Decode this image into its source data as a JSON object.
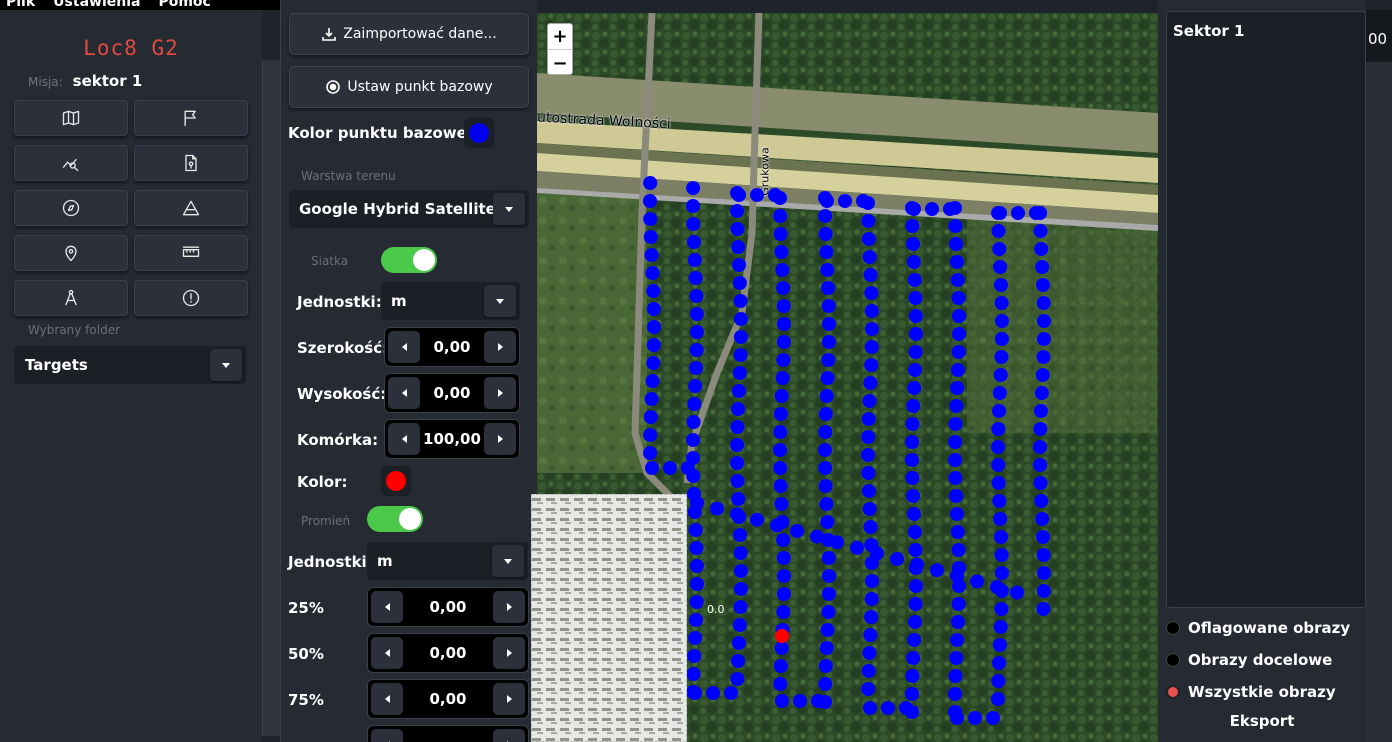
{
  "menu": [
    "Plik",
    "Ustawienia",
    "Pomoc"
  ],
  "app": {
    "logo": "Loc8 G2"
  },
  "mission": {
    "label": "Misja:",
    "value": "sektor 1"
  },
  "tools": [
    "map-icon",
    "flag-icon",
    "search-chart-icon",
    "file-location-icon",
    "compass-icon",
    "triangle-ruler-icon",
    "location-pin-icon",
    "ruler-icon",
    "drafting-compass-icon",
    "alert-circle-icon"
  ],
  "folder": {
    "label": "Wybrany folder",
    "value": "Targets"
  },
  "panel": {
    "import_label": "Zaimportować dane...",
    "base_point_label": "Ustaw punkt bazowy",
    "base_color_label": "Kolor punktu bazowego:",
    "base_color": "#0000ee",
    "terrain_section": "Warstwa terenu",
    "terrain_value": "Google Hybrid Satellite",
    "grid_section": "Siatka",
    "grid_enabled": true,
    "grid_units_label": "Jednostki:",
    "grid_units_value": "m",
    "width_label": "Szerokość:",
    "width_value": "0,00",
    "height_label": "Wysokość:",
    "height_value": "0,00",
    "cell_label": "Komórka:",
    "cell_value": "100,00",
    "color_label": "Kolor:",
    "grid_color": "#ff0000",
    "radius_section": "Promień",
    "radius_enabled": true,
    "radius_units_label": "Jednostki:",
    "radius_units_value": "m",
    "p25_label": "25%",
    "p25_value": "0,00",
    "p50_label": "50%",
    "p50_value": "0,00",
    "p75_label": "75%",
    "p75_value": "0,00"
  },
  "map": {
    "zoom_in": "+",
    "zoom_out": "−",
    "road_label_1": "utostrada Wolności",
    "road_label_2": "Grukowa",
    "thumb_label": "0.0",
    "point_color": "#0000ff",
    "selected_point_color": "#ff0000"
  },
  "right": {
    "sector_title": "Sektor 1",
    "legend": [
      "Oflagowane obrazy",
      "Obrazy docelowe",
      "Wszystkie obrazy"
    ],
    "export_label": "Eksport",
    "cut_value": "00"
  }
}
